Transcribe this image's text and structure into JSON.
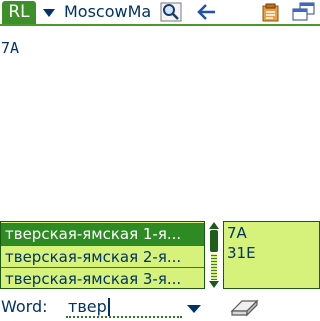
{
  "toolbar": {
    "logo_text": "RL",
    "dictionary_name": "MoscowMa",
    "icons": {
      "dropdown": "chevron-down-icon",
      "search": "magnifier-icon",
      "back": "back-arrow-icon",
      "notes": "notepad-icon",
      "windows": "windows-icon"
    },
    "accent_color": "#3d8f2a"
  },
  "article": {
    "text": "7A"
  },
  "results": {
    "items": [
      "тверская-ямская 1-я...",
      "тверская-ямская 2-я...",
      "тверская-ямская 3-я..."
    ],
    "selected_index": 0,
    "highlight_color": "#d7f27a"
  },
  "translations": {
    "items": [
      "7A",
      "31E"
    ]
  },
  "input": {
    "label": "Word:",
    "value": "твер",
    "icons": {
      "dropdown": "chevron-down-icon",
      "clear": "eraser-icon"
    }
  }
}
